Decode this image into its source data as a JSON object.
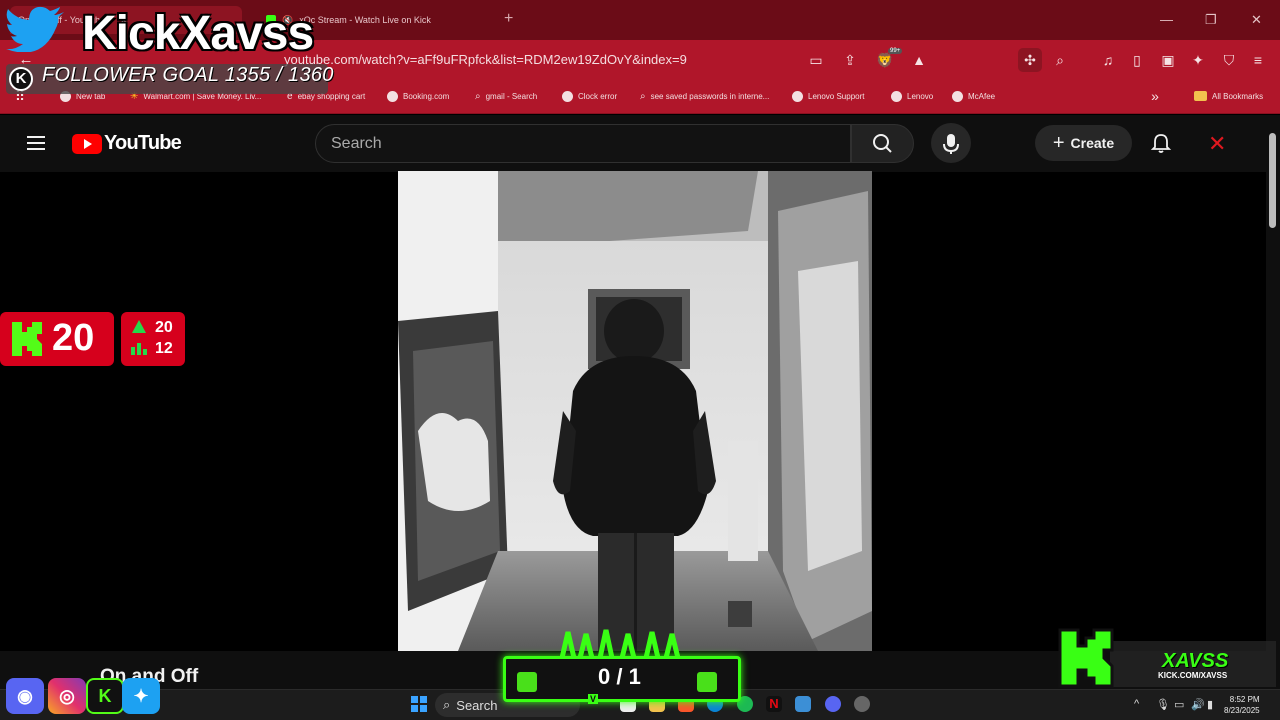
{
  "browser": {
    "tabs": [
      {
        "label": "On and Off - YouTube"
      },
      {
        "label": "xQc Stream - Watch Live on Kick"
      }
    ],
    "url": "youtube.com/watch?v=aFf9uFRpfck&list=RDM2ew19ZdOvY&index=9",
    "brave_badge": "99+",
    "bookmarks": [
      {
        "label": "New tab"
      },
      {
        "label": "Walmart.com | Save Money. Liv..."
      },
      {
        "label": "ebay shopping cart"
      },
      {
        "label": "Booking.com"
      },
      {
        "label": "gmail - Search"
      },
      {
        "label": "Clock error"
      },
      {
        "label": "see saved passwords in interne..."
      },
      {
        "label": "Lenovo Support"
      },
      {
        "label": "Lenovo"
      },
      {
        "label": "McAfee"
      }
    ],
    "all_bookmarks": "All Bookmarks"
  },
  "youtube": {
    "logo_text": "YouTube",
    "search_placeholder": "Search",
    "create_label": "Create",
    "video_title": "On and Off"
  },
  "overlay": {
    "channel_name": "KickXavss",
    "follower_goal": "FOLLOWER GOAL 1355 / 1360",
    "viewer_count": "20",
    "stat_top": "20",
    "stat_bottom": "12",
    "goal_progress": "0 / 1",
    "goal_badge": "V",
    "brand_name": "XAVSS",
    "brand_url": "KICK.COM/XAVSS"
  },
  "taskbar": {
    "search_label": "Search",
    "time": "8:52 PM",
    "date": "8/23/2025"
  },
  "colors": {
    "tab_bar": "#6b0c17",
    "toolbar": "#b0162a",
    "youtube_red": "#ff0000",
    "kick_green": "#39ff14",
    "overlay_red": "#d6001c"
  }
}
